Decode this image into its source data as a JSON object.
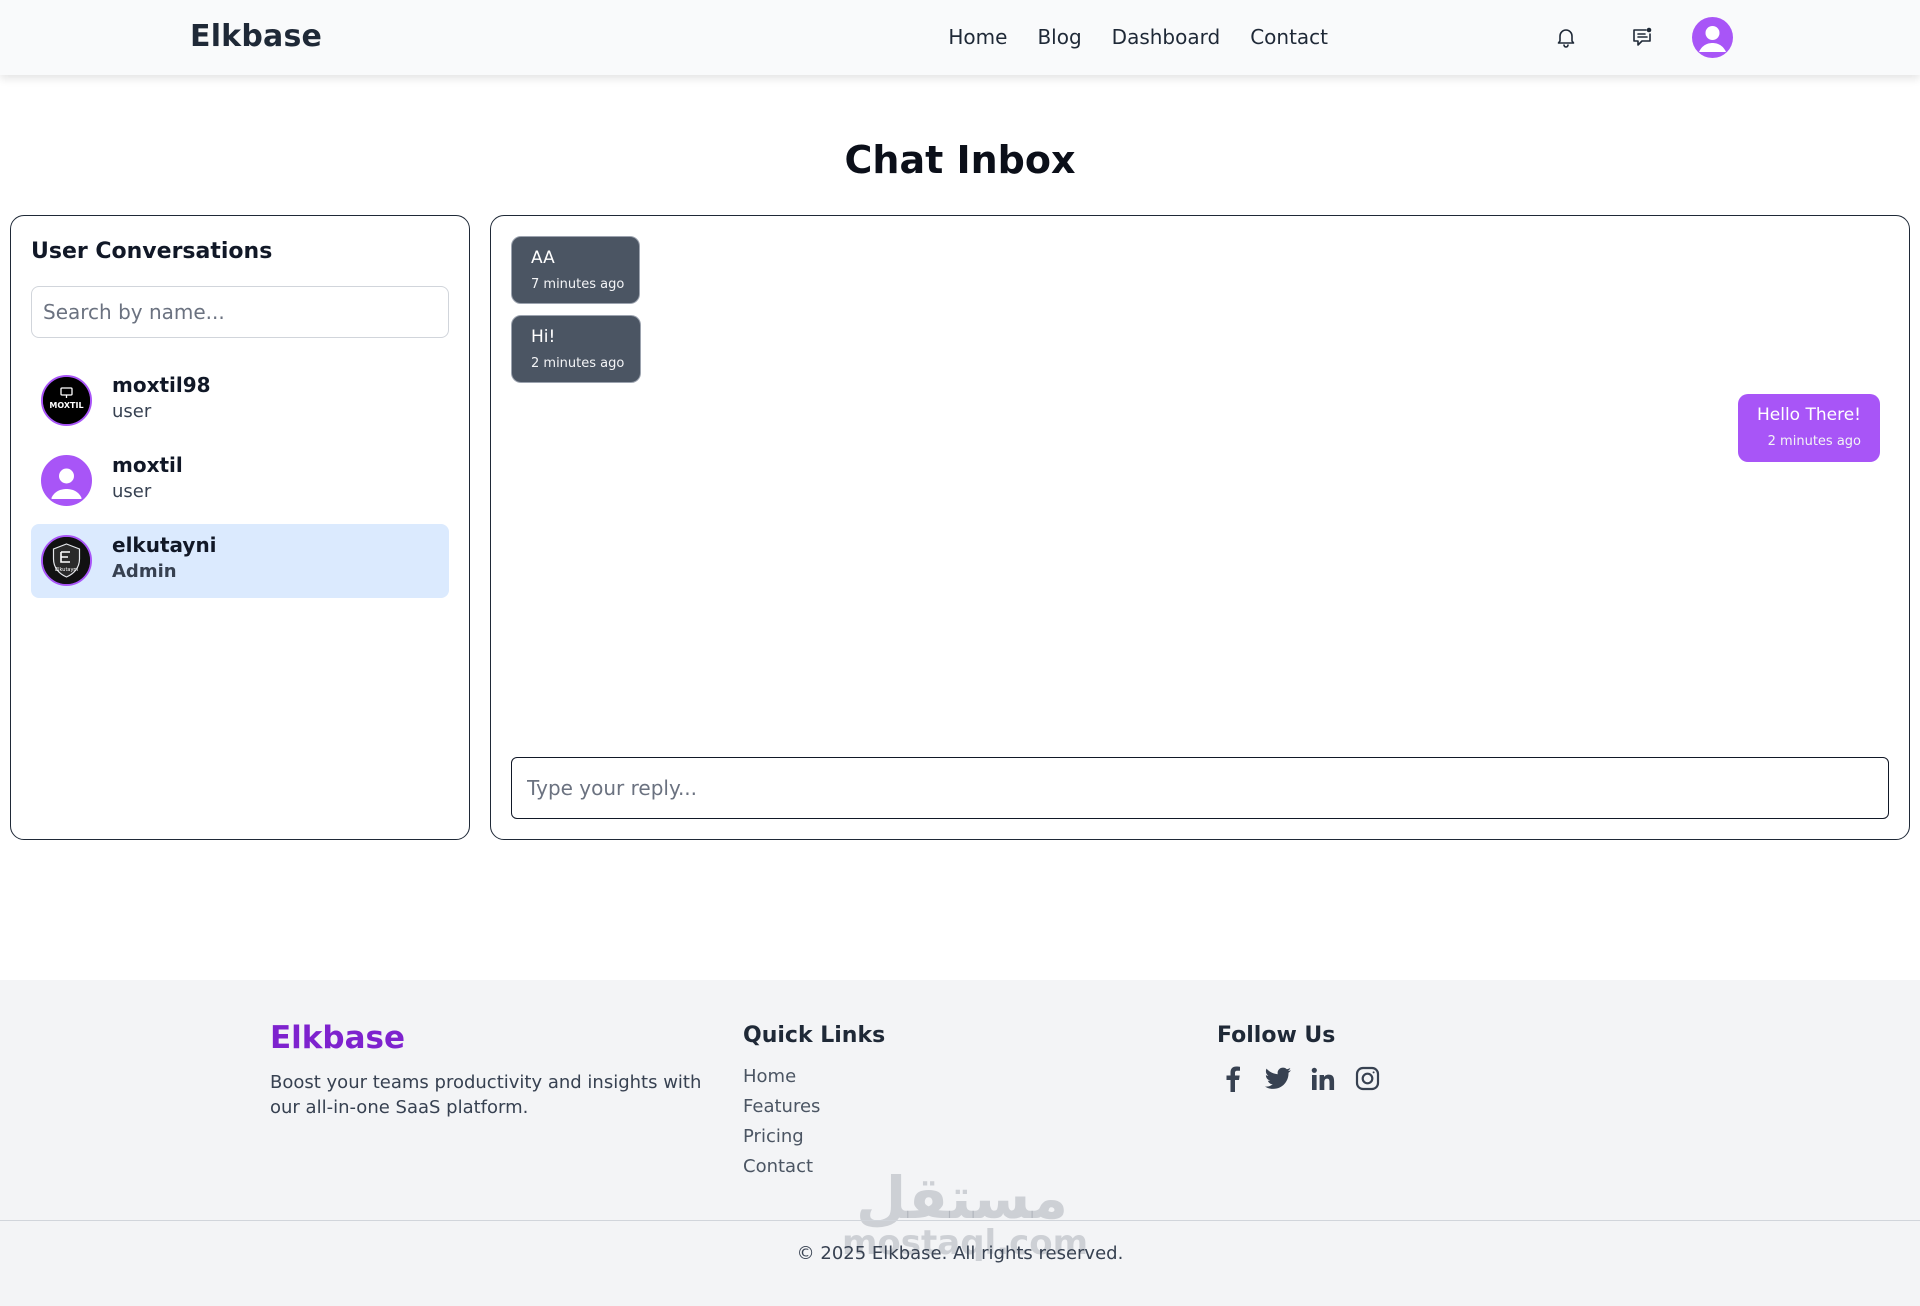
{
  "header": {
    "brand": "Elkbase",
    "nav": [
      "Home",
      "Blog",
      "Dashboard",
      "Contact"
    ],
    "icons": [
      "bell-icon",
      "message-icon",
      "user-avatar"
    ]
  },
  "page": {
    "title": "Chat Inbox"
  },
  "conversations": {
    "title": "User Conversations",
    "search_placeholder": "Search by name...",
    "items": [
      {
        "name": "moxtil98",
        "role": "user",
        "avatar_text": "MOXTIL"
      },
      {
        "name": "moxtil",
        "role": "user"
      },
      {
        "name": "elkutayni",
        "role": "Admin",
        "active": true,
        "avatar_text": "Elkutayni"
      }
    ]
  },
  "chat": {
    "messages": [
      {
        "text": "AA",
        "time": "7 minutes ago",
        "direction": "incoming"
      },
      {
        "text": "Hi!",
        "time": "2 minutes ago",
        "direction": "incoming"
      },
      {
        "text": "Hello There!",
        "time": "2 minutes ago",
        "direction": "outgoing"
      }
    ],
    "reply_placeholder": "Type your reply..."
  },
  "footer": {
    "brand": "Elkbase",
    "description": "Boost your teams productivity and insights with our all-in-one SaaS platform.",
    "quick_links_title": "Quick Links",
    "quick_links": [
      "Home",
      "Features",
      "Pricing",
      "Contact"
    ],
    "follow_title": "Follow Us",
    "social": [
      "facebook-icon",
      "twitter-icon",
      "linkedin-icon",
      "instagram-icon"
    ],
    "copyright": "© 2025 Elkbase. All rights reserved.",
    "watermark": {
      "arabic": "مستقل",
      "latin": "mostaql.com"
    }
  },
  "colors": {
    "accent": "#a855f7",
    "footer_brand": "#7e22ce",
    "incoming_bubble": "#4b5563",
    "active_item": "#dbeafe"
  }
}
